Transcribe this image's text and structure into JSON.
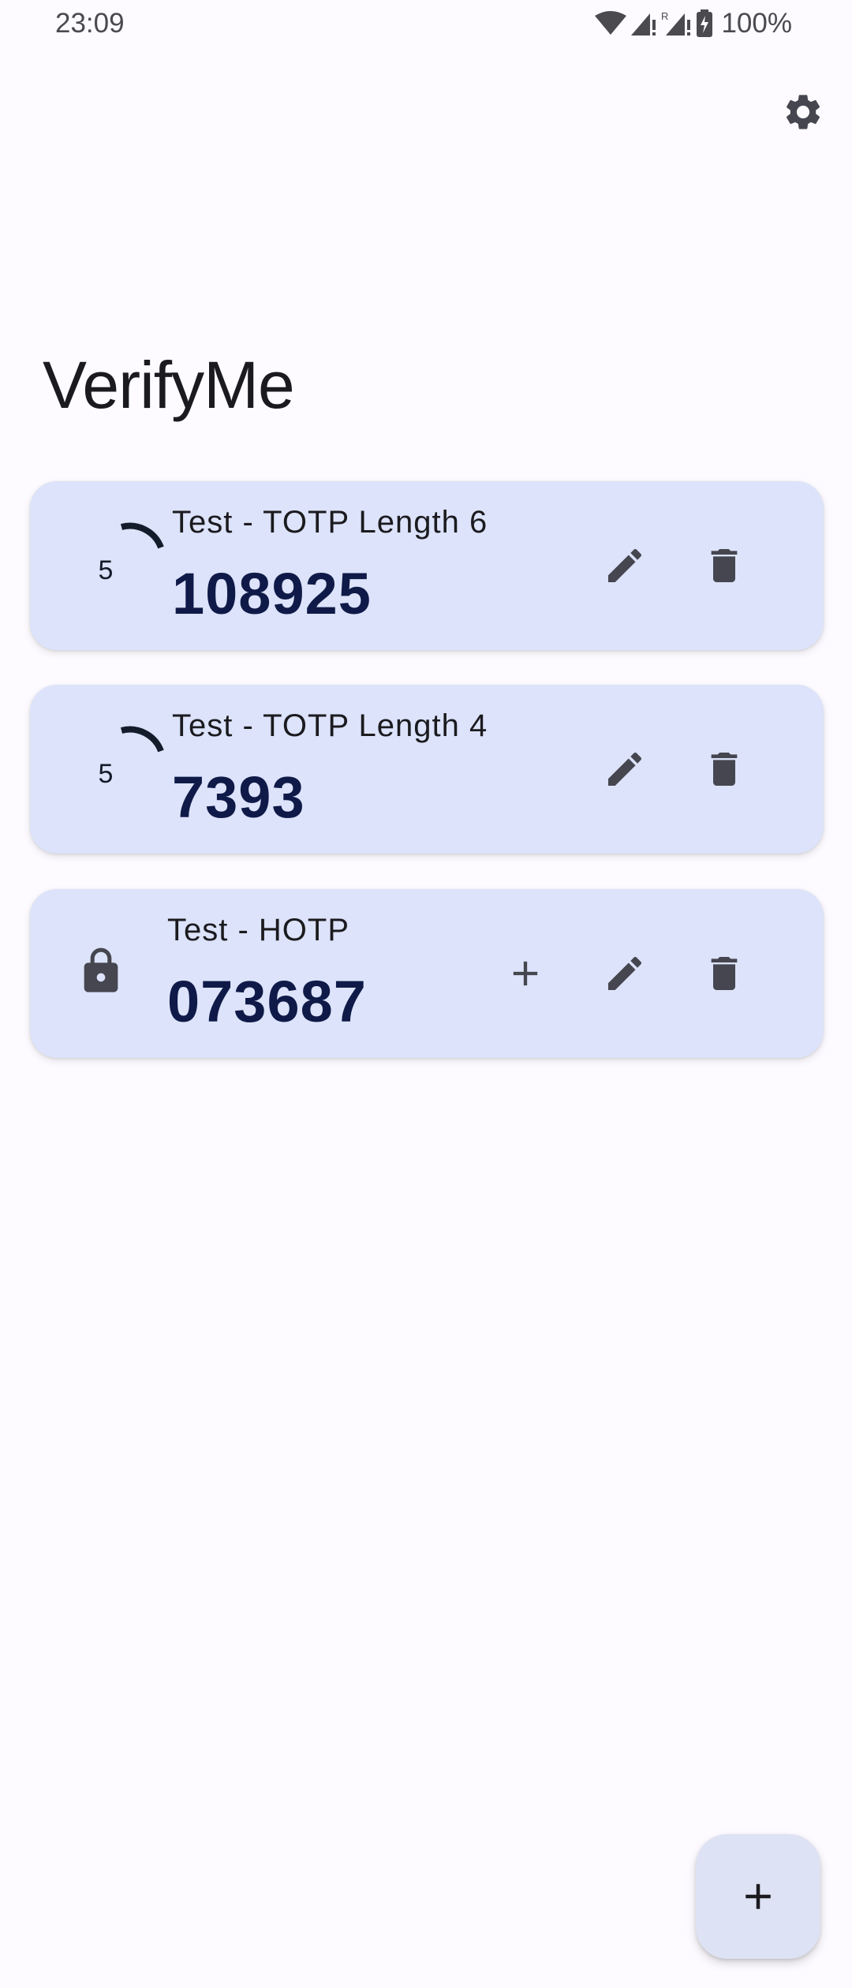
{
  "status_bar": {
    "time": "23:09",
    "battery": "100%"
  },
  "app": {
    "title": "VerifyMe",
    "settings_icon": "gear-icon"
  },
  "tokens": [
    {
      "label": "Test - TOTP Length 6",
      "code": "108925",
      "type": "TOTP",
      "seconds_left": "5"
    },
    {
      "label": "Test - TOTP Length 4",
      "code": "7393",
      "type": "TOTP",
      "seconds_left": "5"
    },
    {
      "label": "Test - HOTP",
      "code": "073687",
      "type": "HOTP"
    }
  ],
  "fab": {
    "icon": "plus-icon"
  },
  "colors": {
    "card": "#dce3fa",
    "code": "#0f1a48",
    "fab": "#dde2f4",
    "background": "#fdfbff"
  }
}
